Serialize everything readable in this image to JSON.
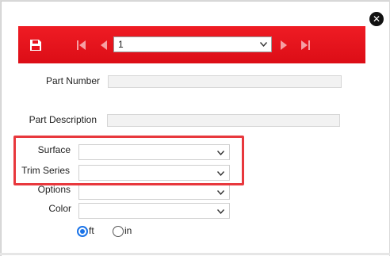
{
  "dialog": {
    "close_glyph": "✕"
  },
  "toolbar": {
    "record_select": {
      "value": "1"
    },
    "icons": [
      "save-icon",
      "first-record-icon",
      "previous-record-icon",
      "next-record-icon",
      "last-record-icon"
    ]
  },
  "form": {
    "part_number": {
      "label": "Part Number",
      "value": ""
    },
    "part_description": {
      "label": "Part Description",
      "value": ""
    },
    "surface": {
      "label": "Surface",
      "value": ""
    },
    "trim_series": {
      "label": "Trim Series",
      "value": ""
    },
    "options": {
      "label": "Options",
      "value": ""
    },
    "color": {
      "label": "Color",
      "value": ""
    },
    "units": {
      "ft_label": "ft",
      "in_label": "in",
      "selected": "ft"
    }
  },
  "colors": {
    "toolbar_red": "#e8141e",
    "highlight_red": "#e8383d",
    "radio_blue": "#1a73e8"
  }
}
